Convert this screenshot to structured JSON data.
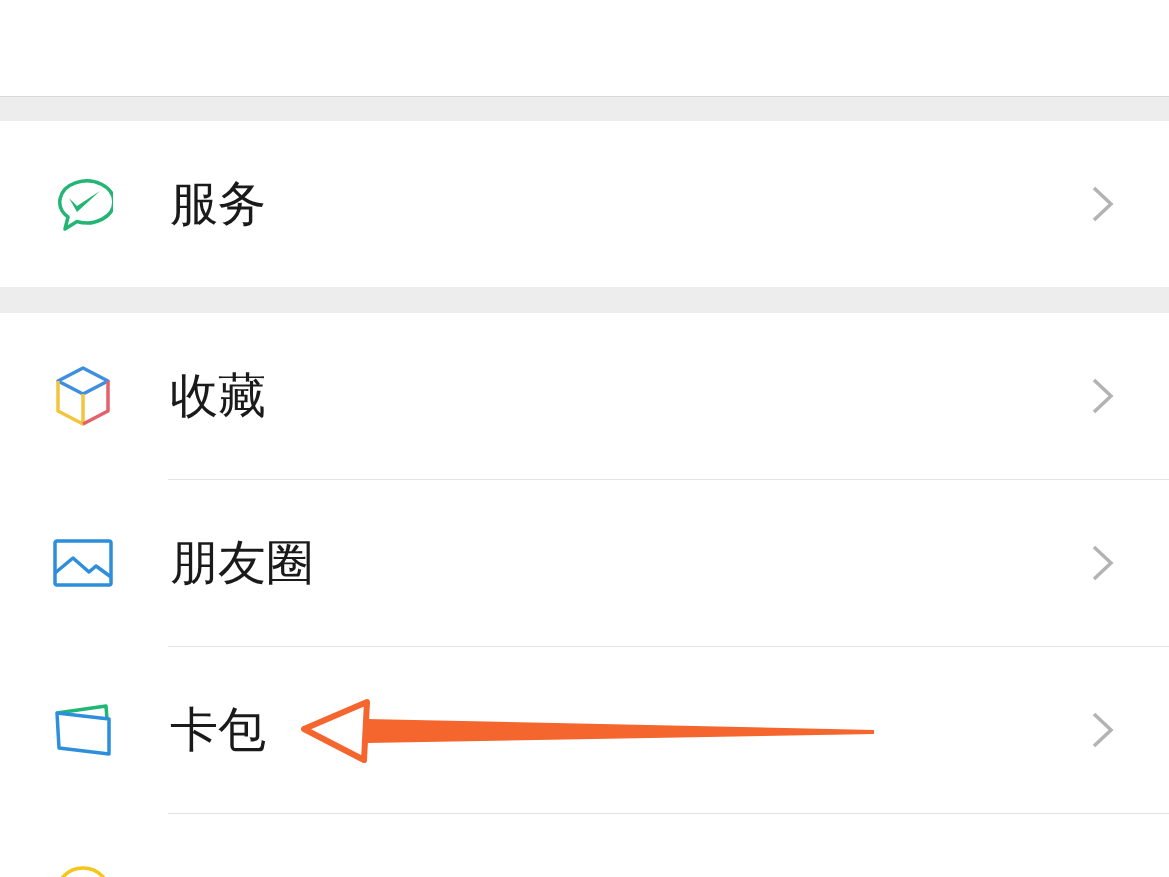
{
  "groups": [
    {
      "items": [
        {
          "label": "服务"
        }
      ]
    },
    {
      "items": [
        {
          "label": "收藏"
        },
        {
          "label": "朋友圈"
        },
        {
          "label": "卡包"
        }
      ]
    }
  ]
}
